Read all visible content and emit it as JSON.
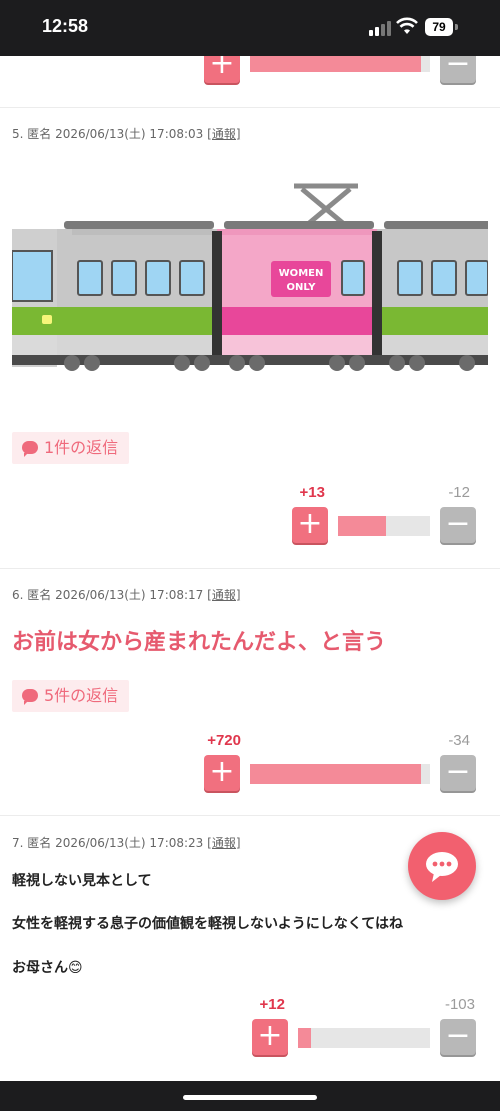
{
  "status": {
    "time": "12:58",
    "battery": "79"
  },
  "posts": [
    {
      "votes": {
        "plus": "",
        "minus": "",
        "ratio": 0.95
      }
    },
    {
      "meta": "5. 匿名 2026/06/13(土) 17:08:03",
      "report": "[通報]",
      "image_text": [
        "WOMEN",
        "ONLY"
      ],
      "replies": "1件の返信",
      "votes": {
        "plus": "+13",
        "minus": "-12",
        "ratio": 0.52
      }
    },
    {
      "meta": "6. 匿名 2026/06/13(土) 17:08:17",
      "report": "[通報]",
      "body": "お前は女から産まれたんだよ、と言う",
      "replies": "5件の返信",
      "votes": {
        "plus": "+720",
        "minus": "-34",
        "ratio": 0.95
      }
    },
    {
      "meta": "7. 匿名 2026/06/13(土) 17:08:23",
      "report": "[通報]",
      "lines": [
        "軽視しない見本として",
        "女性を軽視する息子の価値観を軽視しないようにしなくてはね",
        "お母さん😊"
      ],
      "votes": {
        "plus": "+12",
        "minus": "-103",
        "ratio": 0.1
      }
    }
  ],
  "colors": {
    "accent": "#f1707f",
    "headline": "#e65a6e",
    "train_pink": "#f4a7c8",
    "train_green": "#7ab833"
  }
}
